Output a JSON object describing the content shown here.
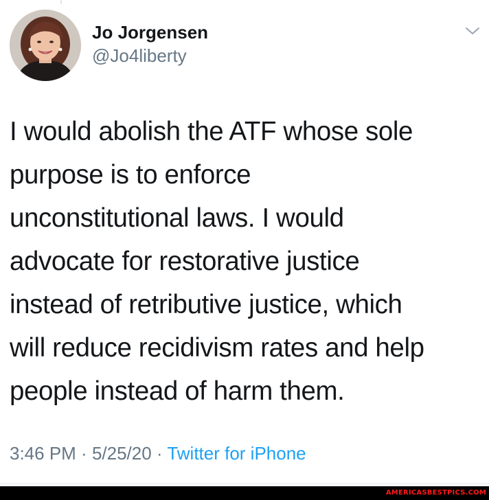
{
  "tweet": {
    "display_name": "Jo Jorgensen",
    "handle": "@Jo4liberty",
    "avatar_icon": "profile-photo",
    "menu_icon": "chevron-down-icon",
    "text": "I would abolish the ATF whose sole\npurpose is to enforce\nunconstitutional laws. I would\nadvocate for restorative justice\ninstead of retributive justice, which\nwill reduce recidivism rates and help\npeople instead of harm them.",
    "time": "3:46 PM",
    "separator": " · ",
    "date": "5/25/20",
    "source": "Twitter for iPhone"
  },
  "watermark": {
    "text": "AMERICASBESTPICS.COM",
    "color": "#ff1a1a"
  },
  "colors": {
    "text": "#14171a",
    "secondary": "#657786",
    "link": "#1da1f2",
    "divider": "#e1e8ed"
  }
}
